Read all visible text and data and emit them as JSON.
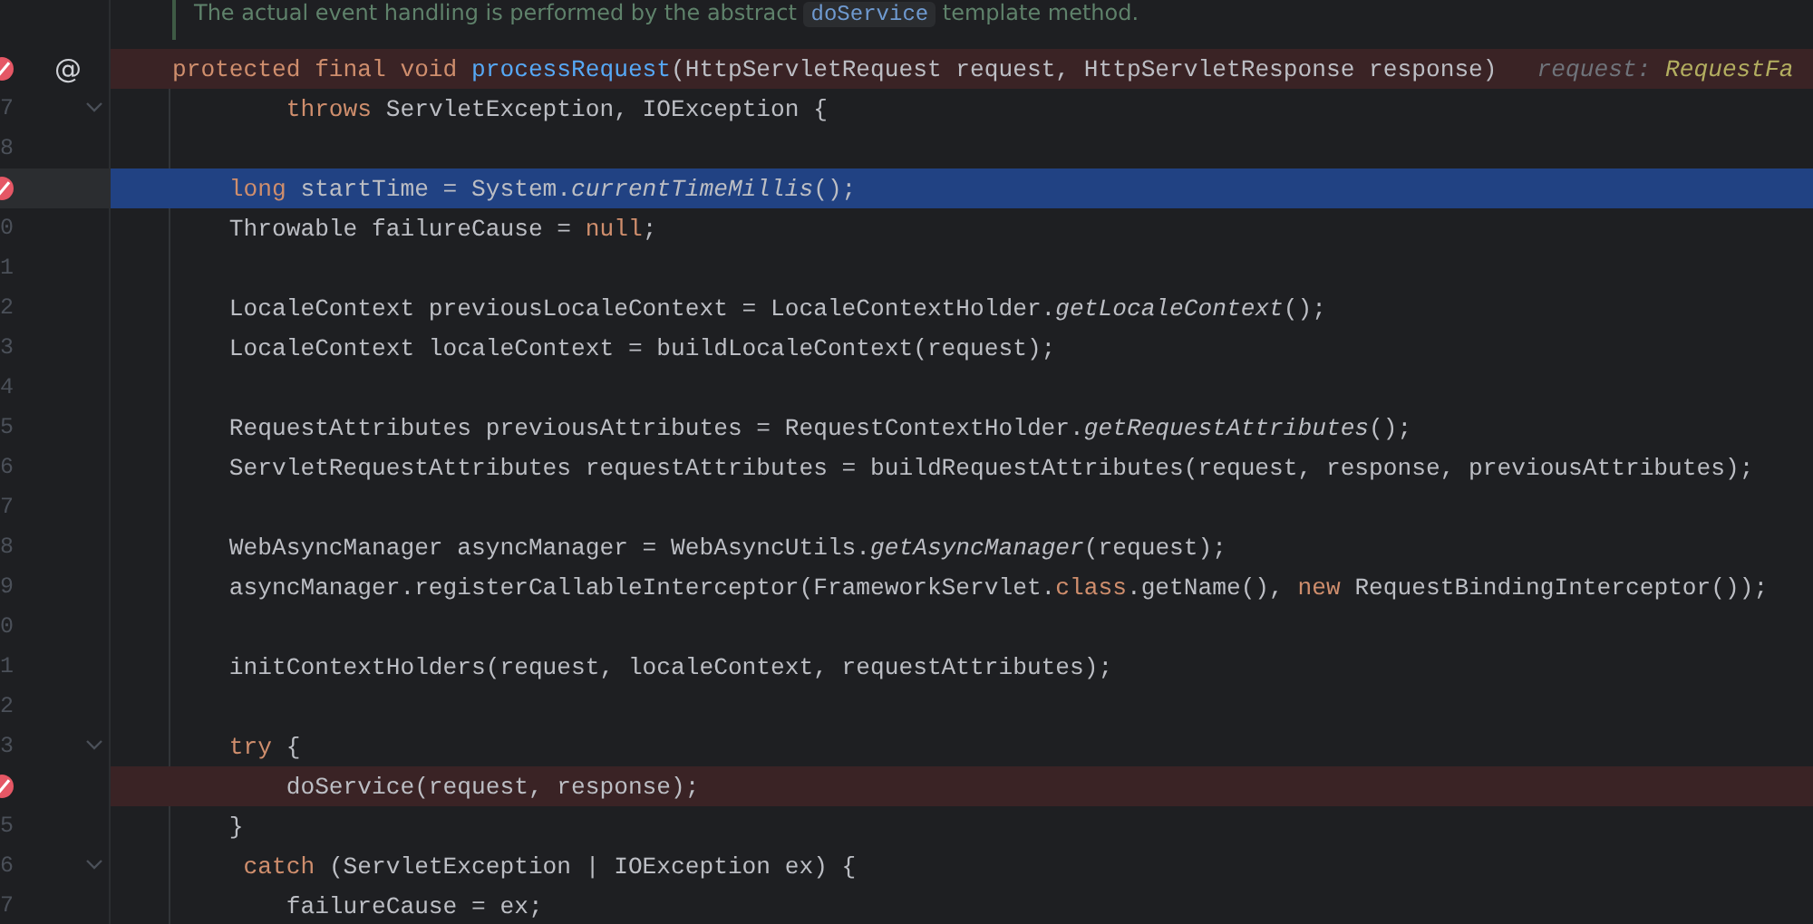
{
  "doc_comment": {
    "parts": [
      {
        "kind": "text",
        "text": "The actual event handling is performed by the abstract "
      },
      {
        "kind": "code",
        "text": "doService"
      },
      {
        "kind": "text",
        "text": " template method."
      }
    ]
  },
  "lines": [
    {
      "breakpoint": true,
      "marker": "@",
      "tokens": [
        {
          "kind": "keyword",
          "text": "protected final void "
        },
        {
          "kind": "declaration",
          "text": "processRequest"
        },
        {
          "kind": "plain",
          "text": "(HttpServletRequest request, HttpServletResponse response)"
        }
      ],
      "hint": {
        "name": "request:",
        "type": "RequestFa"
      }
    },
    {
      "number": "7",
      "fold": true,
      "tokens": [
        {
          "kind": "keyword",
          "text": "        throws "
        },
        {
          "kind": "plain",
          "text": "ServletException, IOException {"
        }
      ]
    },
    {
      "number": "8"
    },
    {
      "breakpoint": true,
      "current": true,
      "tokens": [
        {
          "kind": "keyword",
          "text": "    long "
        },
        {
          "kind": "plain",
          "text": "startTime = System."
        },
        {
          "kind": "static",
          "text": "currentTimeMillis"
        },
        {
          "kind": "plain",
          "text": "();"
        }
      ]
    },
    {
      "number": "0",
      "tokens": [
        {
          "kind": "plain",
          "text": "    Throwable failureCause = "
        },
        {
          "kind": "keyword",
          "text": "null"
        },
        {
          "kind": "plain",
          "text": ";"
        }
      ]
    },
    {
      "number": "1"
    },
    {
      "number": "2",
      "tokens": [
        {
          "kind": "plain",
          "text": "    LocaleContext previousLocaleContext = LocaleContextHolder."
        },
        {
          "kind": "static",
          "text": "getLocaleContext"
        },
        {
          "kind": "plain",
          "text": "();"
        }
      ]
    },
    {
      "number": "3",
      "tokens": [
        {
          "kind": "plain",
          "text": "    LocaleContext localeContext = buildLocaleContext(request);"
        }
      ]
    },
    {
      "number": "4"
    },
    {
      "number": "5",
      "tokens": [
        {
          "kind": "plain",
          "text": "    RequestAttributes previousAttributes = RequestContextHolder."
        },
        {
          "kind": "static",
          "text": "getRequestAttributes"
        },
        {
          "kind": "plain",
          "text": "();"
        }
      ]
    },
    {
      "number": "6",
      "tokens": [
        {
          "kind": "plain",
          "text": "    ServletRequestAttributes requestAttributes = buildRequestAttributes(request, response, previousAttributes);"
        }
      ]
    },
    {
      "number": "7"
    },
    {
      "number": "8",
      "tokens": [
        {
          "kind": "plain",
          "text": "    WebAsyncManager asyncManager = WebAsyncUtils."
        },
        {
          "kind": "static",
          "text": "getAsyncManager"
        },
        {
          "kind": "plain",
          "text": "(request);"
        }
      ]
    },
    {
      "number": "9",
      "tokens": [
        {
          "kind": "plain",
          "text": "    asyncManager.registerCallableInterceptor(FrameworkServlet."
        },
        {
          "kind": "keyword",
          "text": "class"
        },
        {
          "kind": "plain",
          "text": ".getName(), "
        },
        {
          "kind": "keyword",
          "text": "new "
        },
        {
          "kind": "plain",
          "text": "RequestBindingInterceptor());"
        }
      ]
    },
    {
      "number": "0"
    },
    {
      "number": "1",
      "tokens": [
        {
          "kind": "plain",
          "text": "    initContextHolders(request, localeContext, requestAttributes);"
        }
      ]
    },
    {
      "number": "2"
    },
    {
      "number": "3",
      "fold": true,
      "tokens": [
        {
          "kind": "keyword",
          "text": "    try "
        },
        {
          "kind": "plain",
          "text": "{"
        }
      ]
    },
    {
      "breakpoint": true,
      "tokens": [
        {
          "kind": "plain",
          "text": "        doService(request, response);"
        }
      ]
    },
    {
      "number": "5",
      "tokens": [
        {
          "kind": "plain",
          "text": "    }"
        }
      ]
    },
    {
      "number": "6",
      "fold": true,
      "tokens": [
        {
          "kind": "keyword",
          "text": "     catch "
        },
        {
          "kind": "plain",
          "text": "(ServletException | IOException ex) {"
        }
      ]
    },
    {
      "number": "7",
      "tokens": [
        {
          "kind": "plain",
          "text": "        failureCause = ex;"
        }
      ]
    }
  ]
}
